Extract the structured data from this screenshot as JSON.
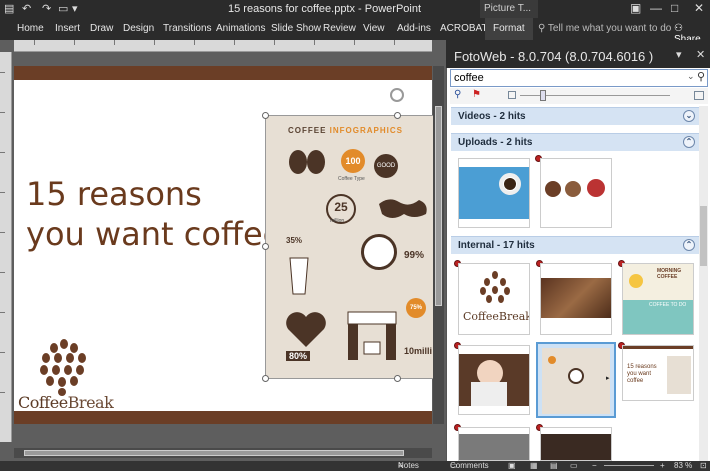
{
  "window": {
    "title": "15 reasons for coffee.pptx - PowerPoint",
    "context_tab": "Picture T...",
    "qa_icons": [
      "save-icon",
      "undo-icon",
      "redo-icon",
      "present-icon",
      "customize-icon"
    ]
  },
  "ribbon": {
    "tabs": [
      "Home",
      "Insert",
      "Draw",
      "Design",
      "Transitions",
      "Animations",
      "Slide Show",
      "Review",
      "View",
      "Add-ins",
      "ACROBAT",
      "Format"
    ],
    "active_tab": "Format",
    "tell_me": "Tell me what you want to do",
    "share": "Share"
  },
  "slide": {
    "title_line1": "15 reasons",
    "title_line2": "you want coffee",
    "logo_text": "Coffee",
    "logo_text2": "Break",
    "infographic": {
      "title_a": "COFFEE ",
      "title_b": "INFOGRAPHICS",
      "stats": [
        "100",
        "25",
        "35%",
        "99%",
        "75%",
        "80%",
        "10milli"
      ],
      "label_million": "million",
      "label_coffee_type": "Coffee Type",
      "label_good": "GOOD"
    }
  },
  "statusbar": {
    "notes": "Notes",
    "comments": "Comments",
    "zoom": "83 %"
  },
  "fotoweb": {
    "title": "FotoWeb - 8.0.704 (8.0.704.6016 )",
    "search_value": "coffee",
    "sections": [
      {
        "label": "Videos - 2 hits",
        "expanded": false
      },
      {
        "label": "Uploads - 2 hits",
        "expanded": true
      },
      {
        "label": "Internal - 17 hits",
        "expanded": true
      }
    ],
    "thumbs": {
      "logo_text1": "Coffee",
      "logo_text2": "Break",
      "morning_text": "MORNING COFFEE",
      "coffee_todo": "COFFEE TO DO",
      "mini_title": "15 reasons you want coffee"
    }
  },
  "colors": {
    "accent_brown": "#6b3e26",
    "title_brown": "#6a3a1d",
    "orange": "#e28b2a",
    "section_blue": "#d5e3f3"
  }
}
